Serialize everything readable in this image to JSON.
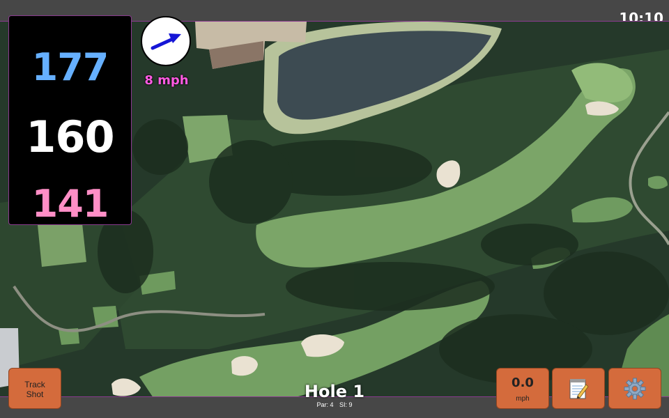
{
  "clock": "10:10",
  "distances": {
    "back": "177",
    "middle": "160",
    "front": "141"
  },
  "wind": {
    "speed": "8 mph",
    "icon": "arrow-icon"
  },
  "hole": {
    "title": "Hole 1",
    "par": "Par: 4",
    "stroke_index": "SI: 9"
  },
  "buttons": {
    "track_shot": {
      "line1": "Track",
      "line2": "Shot"
    },
    "speed": {
      "value": "0.0",
      "unit": "mph"
    },
    "notes_icon": "notepad-icon",
    "settings_icon": "gear-icon"
  },
  "colors": {
    "back_distance": "#66b0ff",
    "middle_distance": "#ffffff",
    "front_distance": "#ff8ec6",
    "wind_text": "#ff5be2",
    "button": "#d46b3c",
    "bar": "#474747"
  }
}
